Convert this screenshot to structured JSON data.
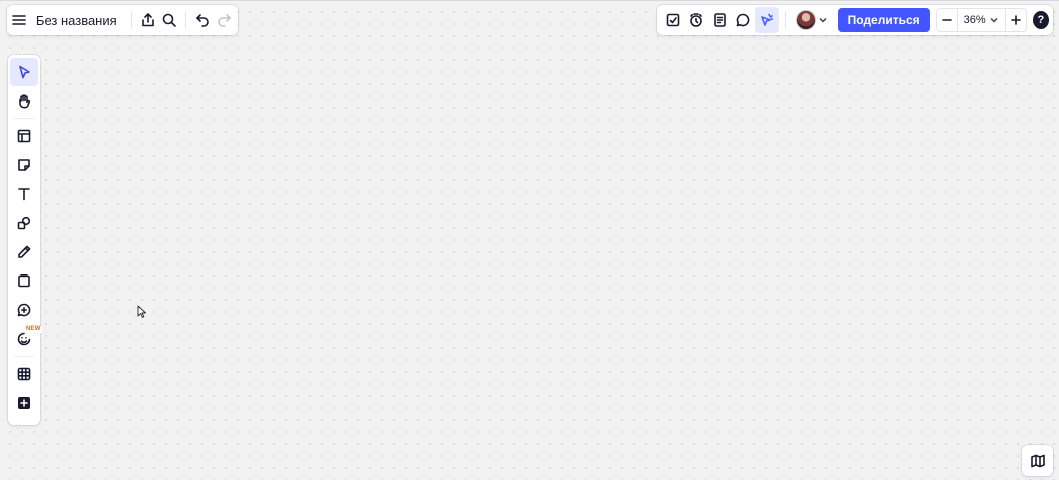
{
  "board": {
    "title": "Без названия"
  },
  "topbar_right": {
    "share_label": "Поделиться",
    "zoom_level": "36%",
    "help_label": "?"
  },
  "left_toolbar": {
    "new_badge": "NEW"
  },
  "colors": {
    "accent": "#4255ff",
    "active_tool_bg": "#e6e8ff",
    "canvas_bg": "#f2f2f2",
    "new_badge": "#e86a1e"
  },
  "icons": {
    "top_left": [
      "menu-icon",
      "export-icon",
      "search-icon",
      "undo-icon",
      "redo-icon"
    ],
    "top_right": [
      "checklist-icon",
      "timer-icon",
      "notes-icon",
      "comment-icon",
      "reactions-cursor-icon",
      "avatar",
      "share",
      "zoom-out-icon",
      "zoom-in-icon",
      "help-icon"
    ],
    "left_tools": [
      "select-icon",
      "hand-icon",
      "templates-icon",
      "sticky-note-icon",
      "text-icon",
      "shapes-icon",
      "pen-icon",
      "frame-icon",
      "comment-add-icon",
      "stickers-icon",
      "grid-icon",
      "apps-plus-icon"
    ],
    "bottom_right": [
      "map-icon"
    ]
  }
}
